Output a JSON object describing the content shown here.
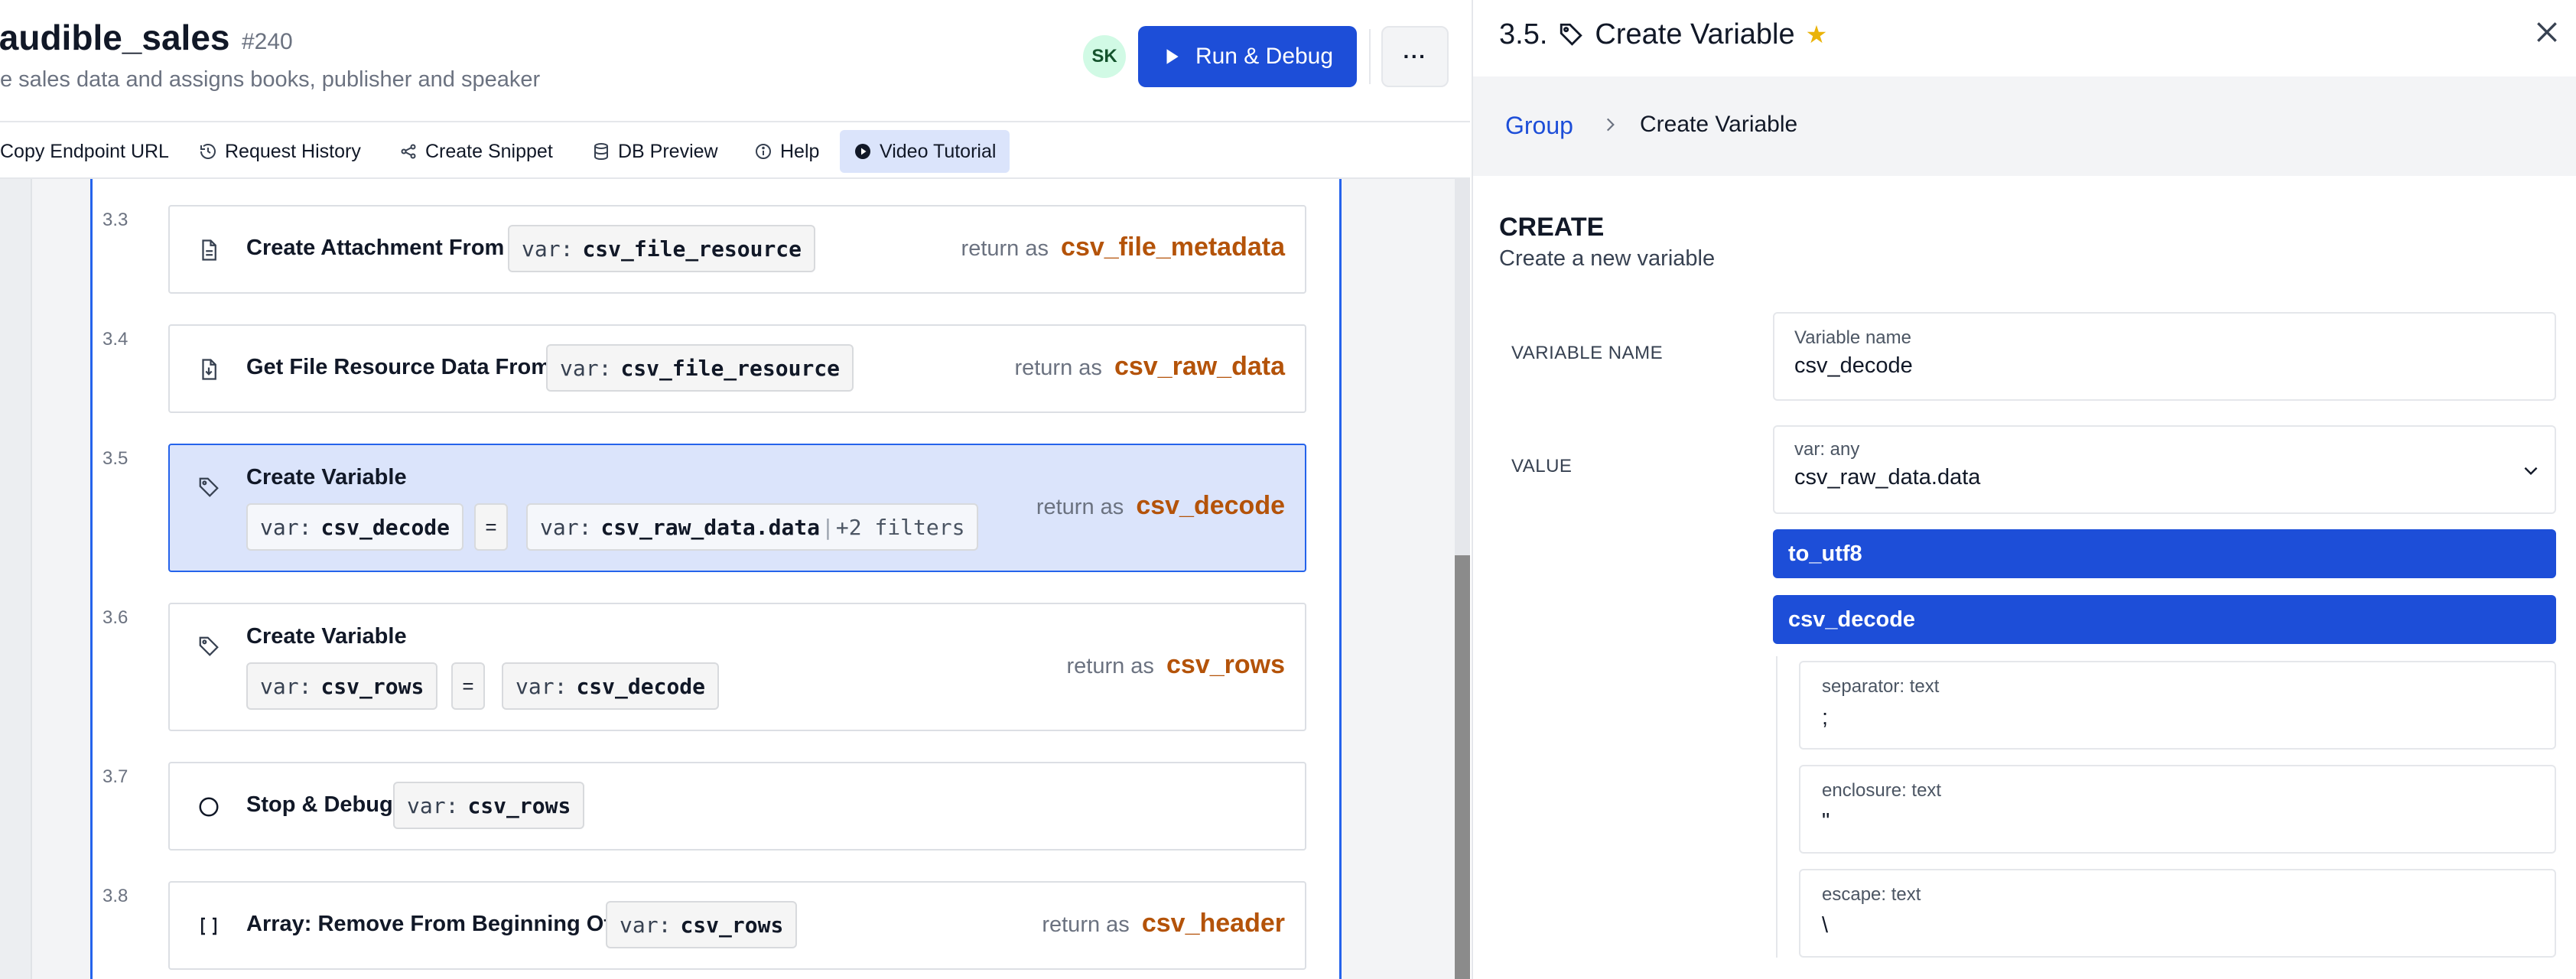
{
  "header": {
    "title": "/audible_sales",
    "title_number": "#240",
    "description": "e sales data and assigns books, publisher and speaker",
    "avatar_initials": "SK",
    "run_button_label": "Run & Debug",
    "more_label": "···"
  },
  "toolbar": {
    "items": [
      {
        "label": "Copy Endpoint URL",
        "icon": "link-icon"
      },
      {
        "label": "Request History",
        "icon": "history-icon"
      },
      {
        "label": "Create Snippet",
        "icon": "share-icon"
      },
      {
        "label": "DB Preview",
        "icon": "database-icon"
      },
      {
        "label": "Help",
        "icon": "info-icon"
      },
      {
        "label": "Video Tutorial",
        "icon": "play-circle-icon"
      }
    ]
  },
  "steps": [
    {
      "number": "3.3",
      "label": "Create Attachment From",
      "chips": [
        {
          "prefix": "var:",
          "name": "csv_file_resource"
        }
      ],
      "return_prefix": "return as",
      "return_name": "csv_file_metadata",
      "icon": "file-icon"
    },
    {
      "number": "3.4",
      "label": "Get File Resource Data From",
      "chips": [
        {
          "prefix": "var:",
          "name": "csv_file_resource"
        }
      ],
      "return_prefix": "return as",
      "return_name": "csv_raw_data",
      "icon": "file-download-icon"
    },
    {
      "number": "3.5",
      "label": "Create Variable",
      "chips": [
        {
          "prefix": "var:",
          "name": "csv_decode"
        },
        {
          "prefix": "var:",
          "name": "csv_raw_data.data",
          "extra": "+2 filters"
        }
      ],
      "equals": "=",
      "return_prefix": "return as",
      "return_name": "csv_decode",
      "icon": "tag-icon"
    },
    {
      "number": "3.6",
      "label": "Create Variable",
      "chips": [
        {
          "prefix": "var:",
          "name": "csv_rows"
        },
        {
          "prefix": "var:",
          "name": "csv_decode"
        }
      ],
      "equals": "=",
      "return_prefix": "return as",
      "return_name": "csv_rows",
      "icon": "tag-icon"
    },
    {
      "number": "3.7",
      "label": "Stop & Debug",
      "chips": [
        {
          "prefix": "var:",
          "name": "csv_rows"
        }
      ],
      "icon": "circle-icon"
    },
    {
      "number": "3.8",
      "label": "Array: Remove From Beginning Of",
      "chips": [
        {
          "prefix": "var:",
          "name": "csv_rows"
        }
      ],
      "return_prefix": "return as",
      "return_name": "csv_header",
      "icon": "brackets-icon"
    }
  ],
  "panel": {
    "step_number": "3.5.",
    "title": "Create Variable",
    "star": "★",
    "close": "✕",
    "breadcrumb_group": "Group",
    "breadcrumb_current": "Create Variable",
    "section_title": "CREATE",
    "section_subtitle": "Create a new variable",
    "variable_name_label": "VARIABLE NAME",
    "variable_name_placeholder": "Variable name",
    "variable_name_value": "csv_decode",
    "value_label": "VALUE",
    "value_type": "var: any",
    "value_value": "csv_raw_data.data",
    "filters": [
      {
        "name": "to_utf8"
      },
      {
        "name": "csv_decode",
        "params": [
          {
            "label": "separator: text",
            "value": ";"
          },
          {
            "label": "enclosure: text",
            "value": "\""
          },
          {
            "label": "escape: text",
            "value": "\\"
          }
        ]
      }
    ]
  },
  "colors": {
    "accent": "#1d4ed8",
    "return_name": "#b45309",
    "active_card": "#dbe4fb",
    "star": "#eab308"
  }
}
